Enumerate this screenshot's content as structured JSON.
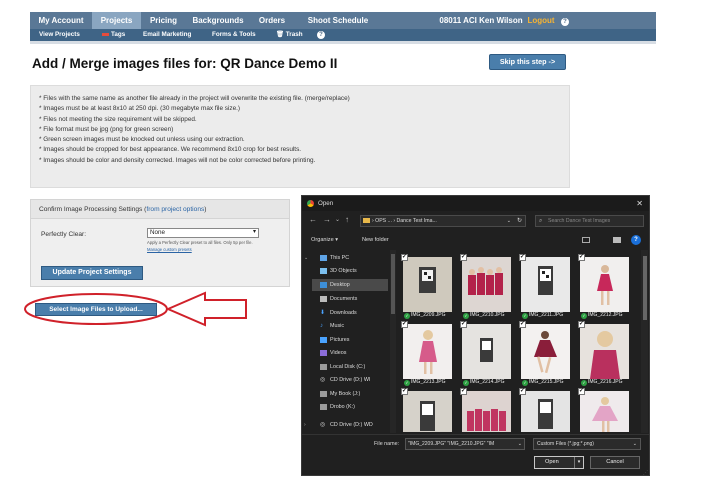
{
  "nav": {
    "items": [
      "My Account",
      "Projects",
      "Pricing",
      "Backgrounds",
      "Orders",
      "Shoot Schedule"
    ],
    "active": "Projects",
    "user": "08011 ACI Ken Wilson",
    "logout": "Logout",
    "help": "?"
  },
  "subnav": {
    "items": [
      "View Projects",
      "Tags",
      "Email Marketing",
      "Forms & Tools",
      "Trash"
    ],
    "help": "?"
  },
  "page": {
    "title": "Add / Merge images files for: QR Dance Demo II",
    "skip_label": "Skip this step ->"
  },
  "info": {
    "lines": [
      "* Files with the same name as another file already in the project will overwrite the existing file. (merge/replace)",
      "* Images must be at least 8x10 at 250 dpi. (30 megabyte max file size.)",
      "* Files not meeting the size requirement will be skipped.",
      "* File format must be jpg (png for green screen)",
      "* Green screen images must be knocked out unless using our extraction.",
      "* Images should be cropped for best appearance. We recommend 8x10 crop for best results.",
      "* Images should be color and density corrected. Images will not be color corrected before printing."
    ]
  },
  "confirm": {
    "header": "Confirm Image Processing Settings (",
    "header_link": "from project options",
    "header_end": ")",
    "pc_label": "Perfectly Clear:",
    "pc_value": "None",
    "pc_help": "Apply a Perfectly Clear preset to all files. Only 5p per file.",
    "pc_link": "Manage custom presets",
    "update_label": "Update Project Settings"
  },
  "select_label": "Select Image Files to Upload...",
  "dialog": {
    "title": "Open",
    "path": [
      "OPS ...",
      "Dance Test Ima..."
    ],
    "search_placeholder": "Search Dance Test Images",
    "organize": "Organize ▾",
    "new_folder": "New folder",
    "tree": [
      "This PC",
      "3D Objects",
      "Desktop",
      "Documents",
      "Downloads",
      "Music",
      "Pictures",
      "Videos",
      "Local Disk (C:)",
      "CD Drive (D:) WI",
      "My Book (J:)",
      "Drobo (K:)",
      "CD Drive (D:) WD"
    ],
    "tree_selected": "Desktop",
    "files": [
      "IMG_2209.JPG",
      "IMG_2210.JPG",
      "IMG_2211.JPG",
      "IMG_2212.JPG",
      "IMG_2213.JPG",
      "IMG_2214.JPG",
      "IMG_2215.JPG",
      "IMG_2216.JPG",
      "",
      "",
      "",
      ""
    ],
    "file_name_label": "File name:",
    "file_name_value": "\"IMG_2209.JPG\" \"IMG_2210.JPG\" \"IM",
    "file_type": "Custom Files (*.jpg;*.png)",
    "open_label": "Open",
    "cancel_label": "Cancel"
  },
  "colors": {
    "nav_bg": "#5a7896",
    "subnav_bg": "#3f6486",
    "button_blue": "#4a7eab",
    "annotation_red": "#d0212a",
    "dialog_bg": "#202020"
  }
}
